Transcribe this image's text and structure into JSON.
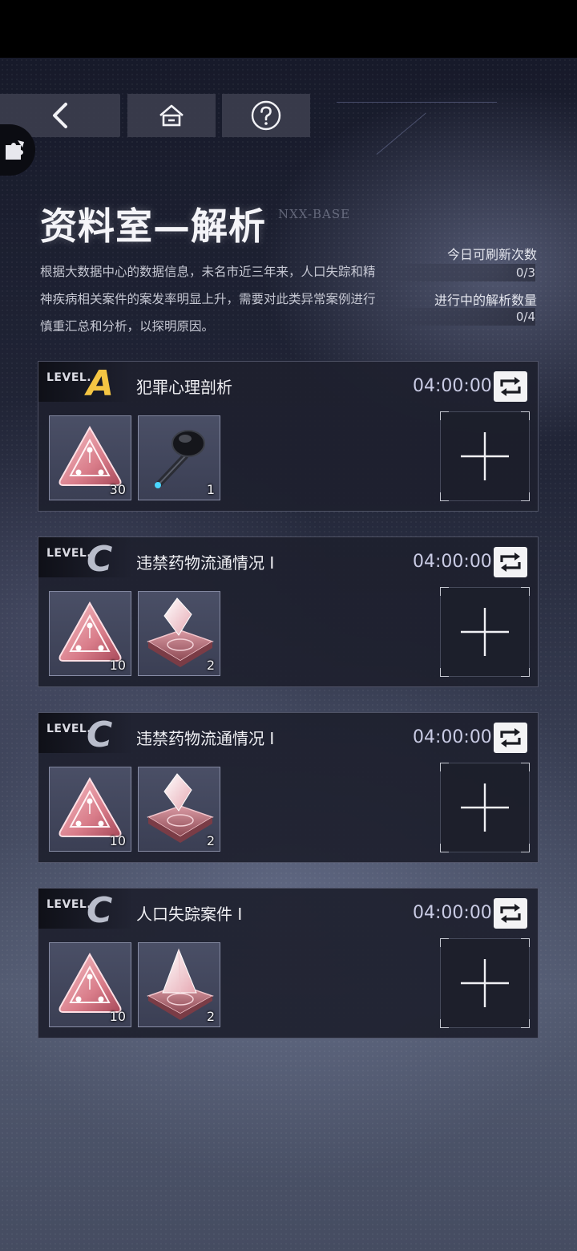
{
  "header": {
    "title": "资料室—解析",
    "title_tag": "NXX-BASE",
    "description": "根据大数据中心的数据信息，未名市近三年来，人口失踪和精神疾病相关案件的案发率明显上升，需要对此类异常案例进行慎重汇总和分析，以探明原因。"
  },
  "nav": {
    "back_icon": "chevron-left-icon",
    "home_icon": "home-icon",
    "help_icon": "question-circle-icon",
    "side_icon": "puzzle-icon"
  },
  "stats": {
    "refresh_label": "今日可刷新次数",
    "refresh_value": "0/3",
    "active_label": "进行中的解析数量",
    "active_value": "0/4"
  },
  "cases": [
    {
      "level_word": "LEVEL.",
      "level": "A",
      "title": "犯罪心理剖析",
      "time": "04:00:00",
      "items": [
        {
          "icon": "pink-triangle-chip-icon",
          "count": "30"
        },
        {
          "icon": "black-earbud-key-icon",
          "count": "1"
        }
      ]
    },
    {
      "level_word": "LEVEL.",
      "level": "C",
      "title": "违禁药物流通情况 Ⅰ",
      "time": "04:00:00",
      "items": [
        {
          "icon": "pink-triangle-chip-icon",
          "count": "10"
        },
        {
          "icon": "pink-crystal-pad-icon",
          "count": "2"
        }
      ]
    },
    {
      "level_word": "LEVEL.",
      "level": "C",
      "title": "违禁药物流通情况 Ⅰ",
      "time": "04:00:00",
      "items": [
        {
          "icon": "pink-triangle-chip-icon",
          "count": "10"
        },
        {
          "icon": "pink-crystal-pad-icon",
          "count": "2"
        }
      ]
    },
    {
      "level_word": "LEVEL.",
      "level": "C",
      "title": "人口失踪案件 Ⅰ",
      "time": "04:00:00",
      "items": [
        {
          "icon": "pink-triangle-chip-icon",
          "count": "10"
        },
        {
          "icon": "pink-pyramid-pad-icon",
          "count": "2"
        }
      ]
    }
  ],
  "colors": {
    "level_a": "#f4c543",
    "level_c": "#b9bdcb",
    "timer": "#c9cbe4"
  }
}
